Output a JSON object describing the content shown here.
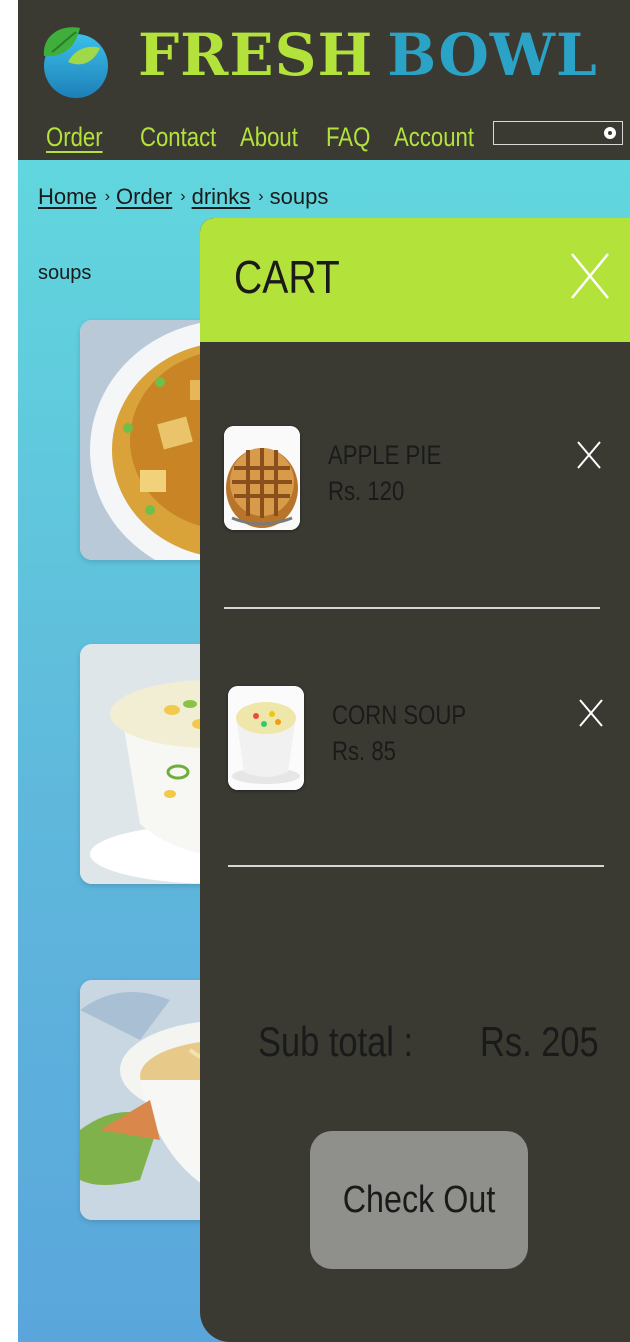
{
  "brand": {
    "word1": "FRESH",
    "word2": "BOWL"
  },
  "nav": {
    "items": [
      {
        "label": "Order",
        "active": true
      },
      {
        "label": "Contact",
        "active": false
      },
      {
        "label": "About",
        "active": false
      },
      {
        "label": "FAQ",
        "active": false
      },
      {
        "label": "Account",
        "active": false
      }
    ],
    "search_value": ""
  },
  "breadcrumb": {
    "home": "Home",
    "order": "Order",
    "drinks": "drinks",
    "current": "soups",
    "separator": "›"
  },
  "section_title": "soups",
  "cart": {
    "title": "CART",
    "items": [
      {
        "name": "APPLE  PIE",
        "price": "Rs. 120"
      },
      {
        "name": "CORN SOUP",
        "price": "Rs. 85"
      }
    ],
    "subtotal_label": "Sub total :",
    "subtotal_value": "Rs. 205",
    "checkout_label": "Check Out"
  },
  "colors": {
    "header_bg": "#3a3a33",
    "accent_green": "#b3e23b",
    "accent_blue": "#2aa3c6",
    "page_top": "#62dede",
    "page_bottom": "#5aa6dc",
    "checkout_bg": "#8f8f8b"
  }
}
